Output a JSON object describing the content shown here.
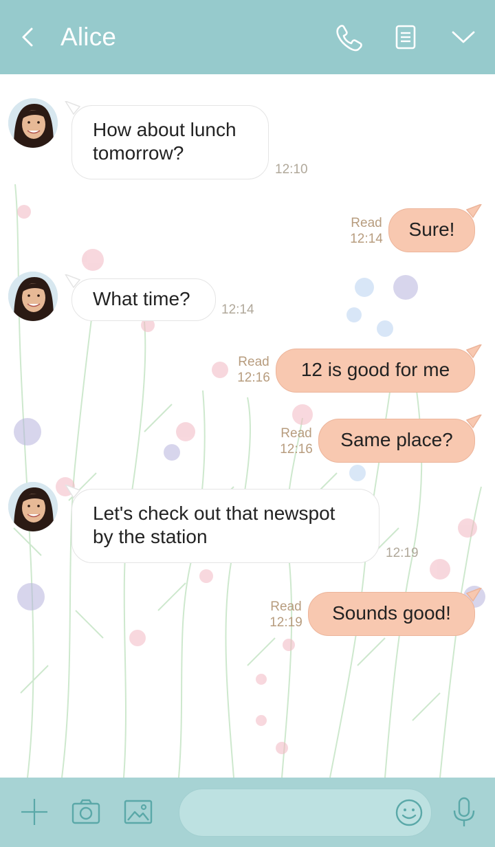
{
  "header": {
    "title": "Alice",
    "back_icon": "chevron-left-icon",
    "call_icon": "phone-icon",
    "notes_icon": "notes-icon",
    "menu_icon": "chevron-down-icon"
  },
  "messages": [
    {
      "direction": "in",
      "text_lines": [
        "How about lunch",
        "tomorrow?"
      ],
      "time": "12:10"
    },
    {
      "direction": "out",
      "text": "Sure!",
      "read_label": "Read",
      "time": "12:14"
    },
    {
      "direction": "in",
      "text": "What time?",
      "time": "12:14"
    },
    {
      "direction": "out",
      "text": "12 is good for me",
      "read_label": "Read",
      "time": "12:16"
    },
    {
      "direction": "out",
      "text": "Same place?",
      "read_label": "Read",
      "time": "12:16"
    },
    {
      "direction": "in",
      "text_lines": [
        "Let's check out that newspot",
        "by the station"
      ],
      "time": "12:19"
    },
    {
      "direction": "out",
      "text": "Sounds good!",
      "read_label": "Read",
      "time": "12:19"
    }
  ],
  "bottom_bar": {
    "add_icon": "plus-icon",
    "camera_icon": "camera-icon",
    "image_icon": "image-icon",
    "input_value": "",
    "emoji_icon": "smiley-icon",
    "mic_icon": "microphone-icon"
  },
  "colors": {
    "header_bg": "#96cacc",
    "bottom_bg": "#a7d3d4",
    "outgoing_bubble": "#f8c8b0",
    "incoming_bubble": "#ffffff",
    "read_text": "#b79c7e"
  }
}
